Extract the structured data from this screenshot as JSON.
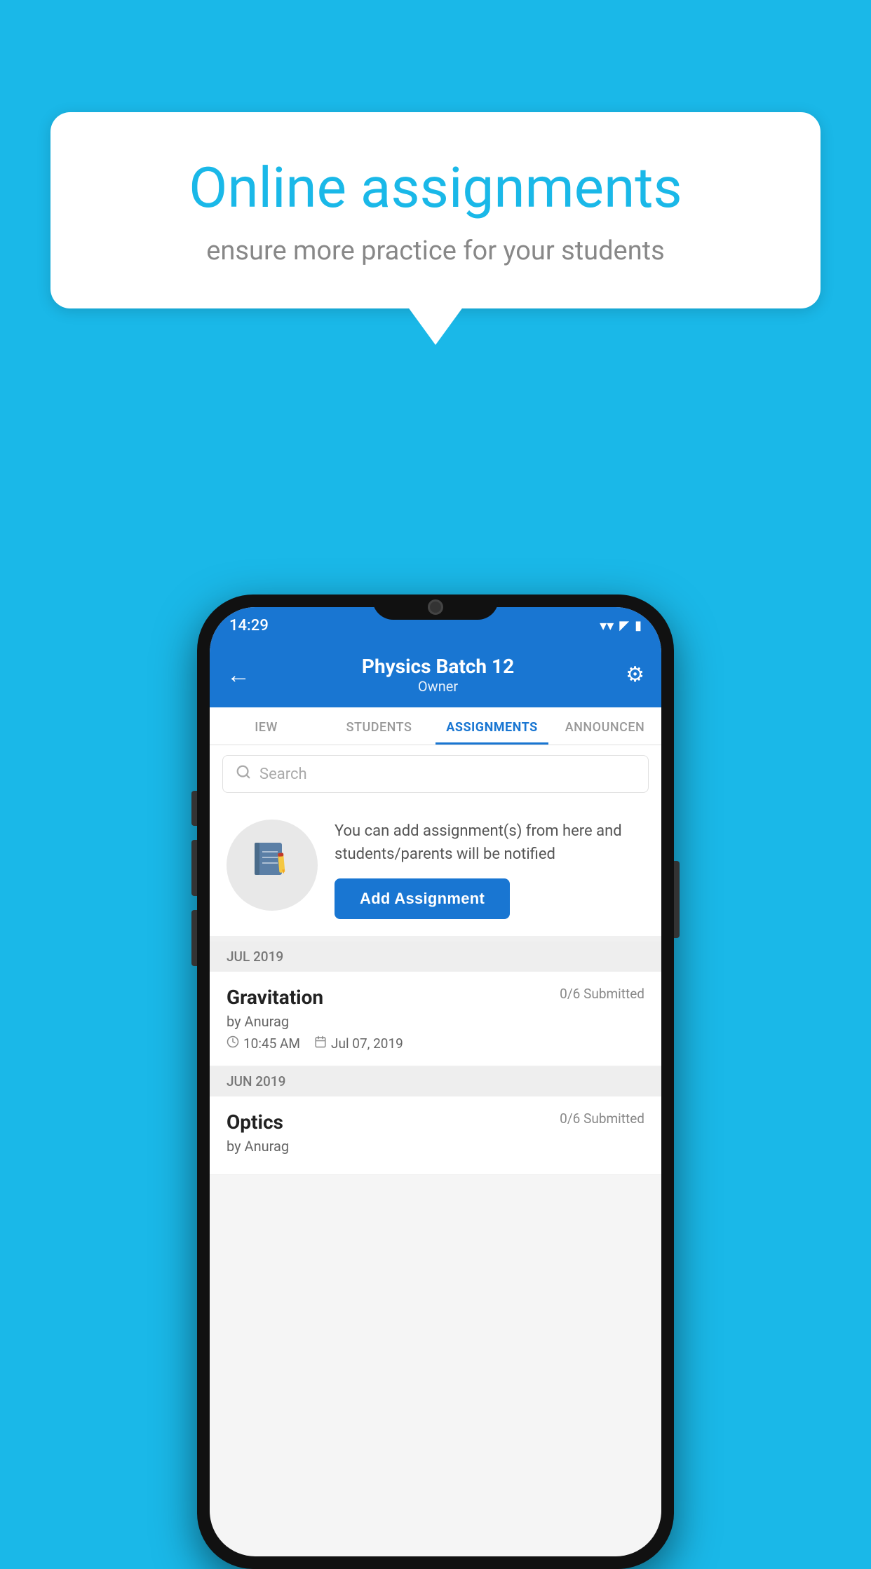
{
  "background": {
    "color": "#1ab8e8"
  },
  "speech_bubble": {
    "title": "Online assignments",
    "subtitle": "ensure more practice for your students"
  },
  "phone": {
    "status_bar": {
      "time": "14:29",
      "wifi": "▼",
      "signal": "▲",
      "battery": "▮"
    },
    "header": {
      "title": "Physics Batch 12",
      "subtitle": "Owner",
      "back_icon": "←",
      "gear_icon": "⚙"
    },
    "tabs": [
      {
        "label": "IEW",
        "active": false
      },
      {
        "label": "STUDENTS",
        "active": false
      },
      {
        "label": "ASSIGNMENTS",
        "active": true
      },
      {
        "label": "ANNOUNCE...",
        "active": false
      }
    ],
    "search": {
      "placeholder": "Search"
    },
    "add_assignment_section": {
      "description": "You can add assignment(s) from here and students/parents will be notified",
      "button_label": "Add Assignment"
    },
    "assignment_groups": [
      {
        "month": "JUL 2019",
        "assignments": [
          {
            "name": "Gravitation",
            "submitted": "0/6 Submitted",
            "by": "by Anurag",
            "time": "10:45 AM",
            "date": "Jul 07, 2019"
          }
        ]
      },
      {
        "month": "JUN 2019",
        "assignments": [
          {
            "name": "Optics",
            "submitted": "0/6 Submitted",
            "by": "by Anurag",
            "time": "",
            "date": ""
          }
        ]
      }
    ]
  }
}
